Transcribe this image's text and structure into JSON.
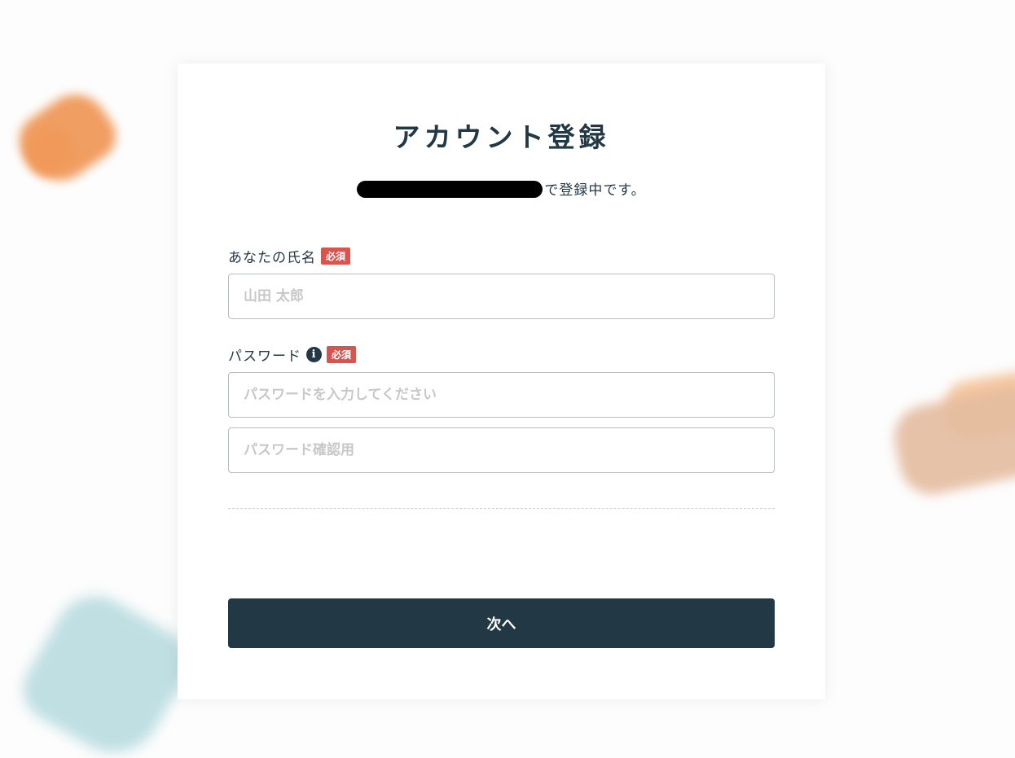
{
  "page": {
    "title": "アカウント登録",
    "subtitle_suffix": "で登録中です。"
  },
  "form": {
    "name": {
      "label": "あなたの氏名",
      "badge": "必須",
      "placeholder": "山田 太郎",
      "value": ""
    },
    "password": {
      "label": "パスワード",
      "info_icon": "info-icon",
      "badge": "必須",
      "placeholder": "パスワードを入力してください",
      "confirm_placeholder": "パスワード確認用",
      "value": "",
      "confirm_value": ""
    },
    "submit_label": "次へ"
  },
  "colors": {
    "primary": "#223845",
    "required_badge": "#d9534f",
    "blob_orange": "#f0995a",
    "blob_peach": "#e4bc9f",
    "blob_teal": "#bfdfe3"
  }
}
